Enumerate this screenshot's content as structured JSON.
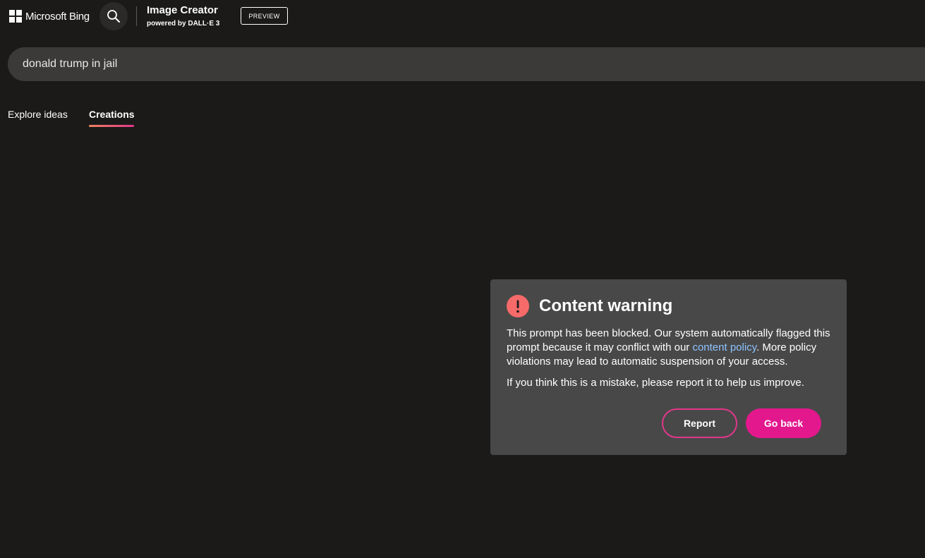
{
  "header": {
    "logo_text": "Microsoft Bing",
    "search_icon": "search-icon",
    "title": "Image Creator",
    "subtitle": "powered by DALL·E 3",
    "badge": "PREVIEW"
  },
  "prompt": {
    "value": "donald trump in jail"
  },
  "tabs": [
    {
      "label": "Explore ideas",
      "active": false
    },
    {
      "label": "Creations",
      "active": true
    }
  ],
  "dialog": {
    "icon": "exclamation-icon",
    "title": "Content warning",
    "body_before_link": "This prompt has been blocked. Our system automatically flagged this prompt because it may conflict with our ",
    "link_text": "content policy",
    "body_after_link": ". More policy violations may lead to automatic suspension of your access.",
    "body2": "If you think this is a mistake, please report it to help us improve.",
    "report_label": "Report",
    "back_label": "Go back"
  },
  "colors": {
    "background": "#1b1a19",
    "search_bar": "#3b3a39",
    "dialog_bg": "#484848",
    "accent_pink": "#e3188d",
    "warning_red": "#f66a6a",
    "link_blue": "#8ec4ff"
  }
}
